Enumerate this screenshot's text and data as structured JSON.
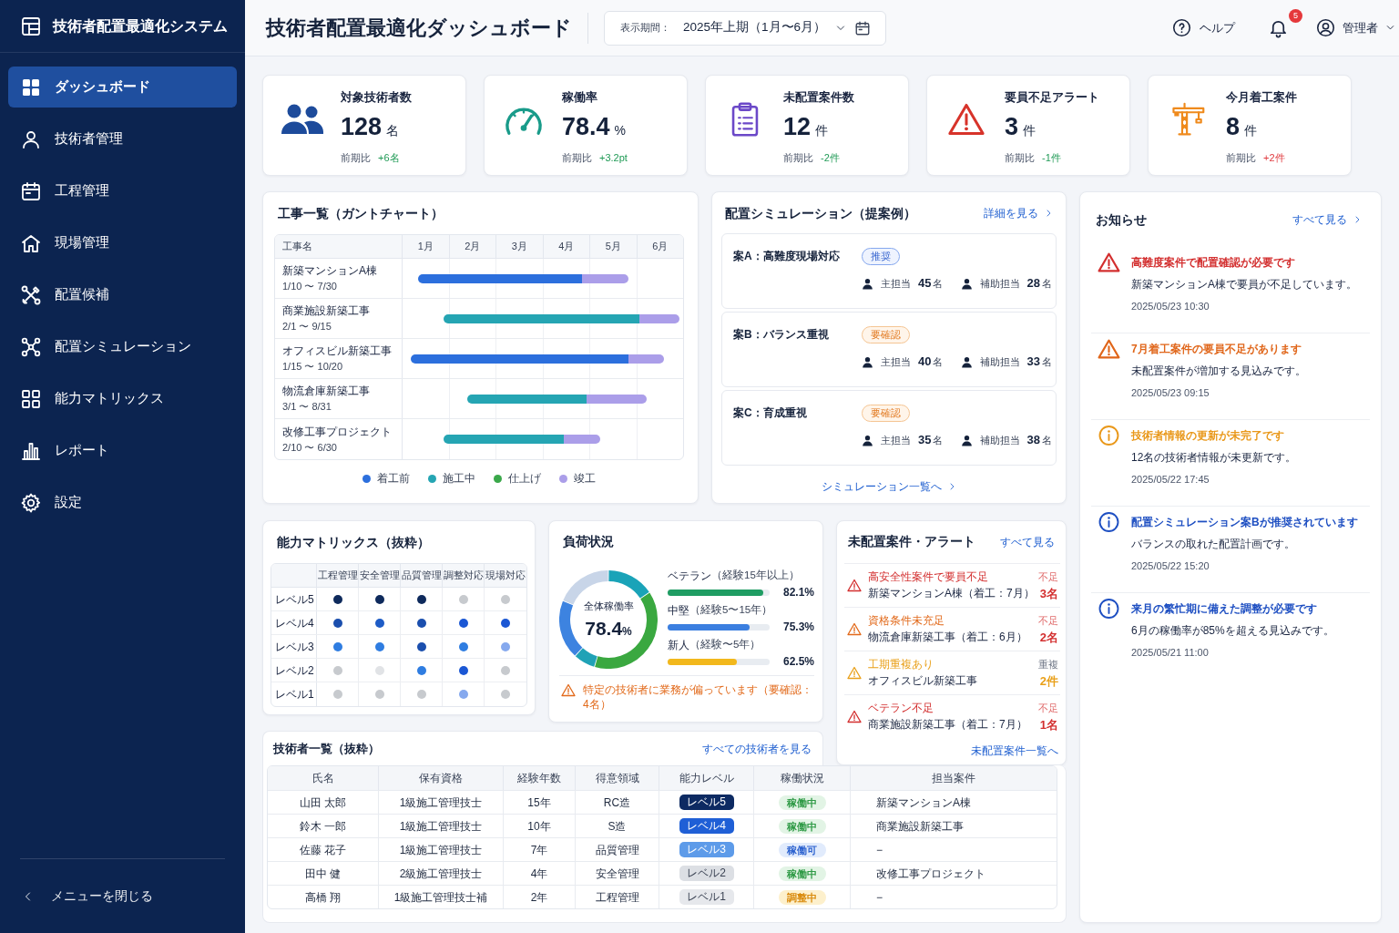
{
  "sidebar": {
    "title": "技術者配置最適化システム",
    "items": [
      {
        "label": "ダッシュボード",
        "selected": true
      },
      {
        "label": "技術者管理",
        "selected": false
      },
      {
        "label": "工程管理",
        "selected": false
      },
      {
        "label": "現場管理",
        "selected": false
      },
      {
        "label": "配置候補",
        "selected": false
      },
      {
        "label": "配置シミュレーション",
        "selected": false
      },
      {
        "label": "能力マトリックス",
        "selected": false
      },
      {
        "label": "レポート",
        "selected": false
      },
      {
        "label": "設定",
        "selected": false
      }
    ],
    "collapse_label": "メニューを閉じる"
  },
  "header": {
    "title": "技術者配置最適化ダッシュボード",
    "period_label": "表示期間：",
    "period_value": "2025年上期（1月〜6月）",
    "help_label": "ヘルプ",
    "notification_count": "5",
    "user_label": "管理者"
  },
  "kpis": [
    {
      "label": "対象技術者数",
      "value": "128",
      "unit": "名",
      "compare_label": "前期比",
      "delta": "+6名",
      "favorable": true
    },
    {
      "label": "稼働率",
      "value": "78.4",
      "unit": "%",
      "compare_label": "前期比",
      "delta": "+3.2pt",
      "favorable": true
    },
    {
      "label": "未配置案件数",
      "value": "12",
      "unit": "件",
      "compare_label": "前期比",
      "delta": "-2件",
      "favorable": true
    },
    {
      "label": "要員不足アラート",
      "value": "3",
      "unit": "件",
      "compare_label": "前期比",
      "delta": "-1件",
      "favorable": true
    },
    {
      "label": "今月着工案件",
      "value": "8",
      "unit": "件",
      "compare_label": "前期比",
      "delta": "+2件",
      "favorable": false
    }
  ],
  "gantt": {
    "title": "工事一覧（ガントチャート）",
    "name_header": "工事名",
    "months": [
      "1月",
      "2月",
      "3月",
      "4月",
      "5月",
      "6月"
    ],
    "rows": [
      {
        "name": "新築マンションA棟",
        "dates": "1/10 〜 7/30",
        "segments": [
          {
            "color": "#2c6fdd"
          },
          {
            "color": "#ab9ee9"
          }
        ]
      },
      {
        "name": "商業施設新築工事",
        "dates": "2/1 〜 9/15",
        "segments": [
          {
            "color": "#25a5b3"
          },
          {
            "color": "#ab9ee9"
          }
        ]
      },
      {
        "name": "オフィスビル新築工事",
        "dates": "1/15 〜 10/20",
        "segments": [
          {
            "color": "#2c6fdd"
          },
          {
            "color": "#ab9ee9"
          }
        ]
      },
      {
        "name": "物流倉庫新築工事",
        "dates": "3/1 〜 8/31",
        "segments": [
          {
            "color": "#25a5b3"
          },
          {
            "color": "#ab9ee9"
          }
        ]
      },
      {
        "name": "改修工事プロジェクト",
        "dates": "2/10 〜 6/30",
        "segments": [
          {
            "color": "#25a5b3"
          },
          {
            "color": "#ab9ee9"
          }
        ]
      }
    ],
    "legend": [
      {
        "label": "着工前",
        "color": "#2c6fdd"
      },
      {
        "label": "施工中",
        "color": "#25a5b3"
      },
      {
        "label": "仕上げ",
        "color": "#3aa84a"
      },
      {
        "label": "竣工",
        "color": "#ab9ee9"
      }
    ]
  },
  "simulation": {
    "title": "配置シミュレーション（提案例）",
    "link": "詳細を見る",
    "plans": [
      {
        "name": "案A：高難度現場対応",
        "badge": {
          "label": "推奨",
          "kind": "recommended"
        },
        "staff": [
          {
            "role": "主担当",
            "count": "45",
            "unit": "名"
          },
          {
            "role": "補助担当",
            "count": "28",
            "unit": "名"
          }
        ]
      },
      {
        "name": "案B：バランス重視",
        "badge": {
          "label": "要確認",
          "kind": "check"
        },
        "staff": [
          {
            "role": "主担当",
            "count": "40",
            "unit": "名"
          },
          {
            "role": "補助担当",
            "count": "33",
            "unit": "名"
          }
        ]
      },
      {
        "name": "案C：育成重視",
        "badge": {
          "label": "要確認",
          "kind": "check"
        },
        "staff": [
          {
            "role": "主担当",
            "count": "35",
            "unit": "名"
          },
          {
            "role": "補助担当",
            "count": "38",
            "unit": "名"
          }
        ]
      }
    ],
    "footer_link": "シミュレーション一覧へ"
  },
  "notices": {
    "title": "お知らせ",
    "link": "すべて見る",
    "items": [
      {
        "kind": "critical",
        "title": "高難度案件で配置確認が必要です",
        "body": "新築マンションA棟で要員が不足しています。",
        "time": "2025/05/23 10:30"
      },
      {
        "kind": "warning",
        "title": "7月着工案件の要員不足があります",
        "body": "未配置案件が増加する見込みです。",
        "time": "2025/05/23 09:15"
      },
      {
        "kind": "caution",
        "title": "技術者情報の更新が未完了です",
        "body": "12名の技術者情報が未更新です。",
        "time": "2025/05/22 17:45"
      },
      {
        "kind": "info",
        "title": "配置シミュレーション案Bが推奨されています",
        "body": "バランスの取れた配置計画です。",
        "time": "2025/05/22 15:20"
      },
      {
        "kind": "info",
        "title": "来月の繁忙期に備えた調整が必要です",
        "body": "6月の稼働率が85%を超える見込みです。",
        "time": "2025/05/21 11:00"
      }
    ]
  },
  "skill_matrix": {
    "title": "能力マトリックス（抜粋）",
    "columns": [
      "工程管理",
      "安全管理",
      "品質管理",
      "調整対応",
      "現場対応"
    ],
    "rows": [
      {
        "label": "レベル5",
        "cells": [
          {
            "color": "#0e2a5c"
          },
          {
            "color": "#0e2a5c"
          },
          {
            "color": "#0e2a5c"
          },
          {
            "color": "#c7cace"
          },
          {
            "color": "#c7cace"
          }
        ]
      },
      {
        "label": "レベル4",
        "cells": [
          {
            "color": "#1b4fae"
          },
          {
            "color": "#1e5cc6"
          },
          {
            "color": "#1b4fae"
          },
          {
            "color": "#1b57d4"
          },
          {
            "color": "#1b57d4"
          }
        ]
      },
      {
        "label": "レベル3",
        "cells": [
          {
            "color": "#2f7de1"
          },
          {
            "color": "#2f7de1"
          },
          {
            "color": "#1b4fae"
          },
          {
            "color": "#2f7de1"
          },
          {
            "color": "#86a9ee"
          }
        ]
      },
      {
        "label": "レベル2",
        "cells": [
          {
            "color": "#c7cace"
          },
          {
            "color": "#e1e3e6"
          },
          {
            "color": "#2f7de1"
          },
          {
            "color": "#1b57d4"
          },
          {
            "color": "#c7cace"
          }
        ]
      },
      {
        "label": "レベル1",
        "cells": [
          {
            "color": "#c7cace"
          },
          {
            "color": "#c7cace"
          },
          {
            "color": "#c7cace"
          },
          {
            "color": "#86a9ee"
          },
          {
            "color": "#c7cace"
          }
        ]
      }
    ]
  },
  "load": {
    "title": "負荷状況",
    "overall": {
      "label": "全体稼働率",
      "value": "78.4",
      "unit": "%"
    },
    "groups": [
      {
        "label": "ベテラン",
        "note": "（経験15年以上）",
        "reading": "82.1%",
        "level": 0.94,
        "color": "#1f9d63"
      },
      {
        "label": "中堅",
        "note": "（経験5〜15年）",
        "reading": "75.3%",
        "level": 0.8,
        "color": "#3b7fe0"
      },
      {
        "label": "新人",
        "note": "（経験〜5年）",
        "reading": "62.5%",
        "level": 0.68,
        "color": "#f2b81c"
      }
    ],
    "warning": "特定の技術者に業務が偏っています（要確認：4名）"
  },
  "alerts": {
    "title": "未配置案件・アラート",
    "link": "すべて見る",
    "items": [
      {
        "kind": "critical",
        "title": "高安全性案件で要員不足",
        "project": "新築マンションA棟（着工：7月）",
        "tag": "不足",
        "count": "3名"
      },
      {
        "kind": "warning",
        "title": "資格条件未充足",
        "project": "物流倉庫新築工事（着工：6月）",
        "tag": "不足",
        "count": "2名"
      },
      {
        "kind": "caution",
        "title": "工期重複あり",
        "project": "オフィスビル新築工事",
        "tag": "重複",
        "count": "2件"
      },
      {
        "kind": "critical",
        "title": "ベテラン不足",
        "project": "商業施設新築工事（着工：7月）",
        "tag": "不足",
        "count": "1名"
      }
    ],
    "footer_link": "未配置案件一覧へ"
  },
  "technicians": {
    "title": "技術者一覧（抜粋）",
    "link": "すべての技術者を見る",
    "columns": [
      "氏名",
      "保有資格",
      "経験年数",
      "得意領域",
      "能力レベル",
      "稼働状況",
      "担当案件"
    ],
    "rows": [
      {
        "name": "山田 太郎",
        "license": "1級施工管理技士",
        "years": "15年",
        "specialty": "RC造",
        "skill": {
          "label": "レベル5",
          "color": "#0d2a62"
        },
        "status": {
          "label": "稼働中",
          "kind": "active"
        },
        "project": "新築マンションA棟"
      },
      {
        "name": "鈴木 一郎",
        "license": "1級施工管理技士",
        "years": "10年",
        "specialty": "S造",
        "skill": {
          "label": "レベル4",
          "color": "#1f5fd6"
        },
        "status": {
          "label": "稼働中",
          "kind": "active"
        },
        "project": "商業施設新築工事"
      },
      {
        "name": "佐藤 花子",
        "license": "1級施工管理技士",
        "years": "7年",
        "specialty": "品質管理",
        "skill": {
          "label": "レベル3",
          "color": "#5d9be9"
        },
        "status": {
          "label": "稼働可",
          "kind": "available"
        },
        "project": "−"
      },
      {
        "name": "田中 健",
        "license": "2級施工管理技士",
        "years": "4年",
        "specialty": "安全管理",
        "skill": {
          "label": "レベル2",
          "color": "#dcdfe4"
        },
        "status": {
          "label": "稼働中",
          "kind": "active"
        },
        "project": "改修工事プロジェクト"
      },
      {
        "name": "高橋 翔",
        "license": "1級施工管理技士補",
        "years": "2年",
        "specialty": "工程管理",
        "skill": {
          "label": "レベル1",
          "color": "#e6e8ec"
        },
        "status": {
          "label": "調整中",
          "kind": "adjusting"
        },
        "project": "−"
      }
    ]
  }
}
